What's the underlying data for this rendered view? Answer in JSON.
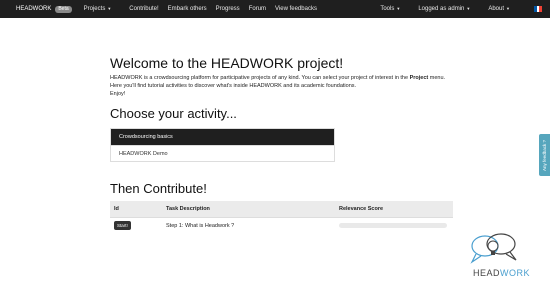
{
  "navbar": {
    "brand": "HEADWORK",
    "beta": "Beta",
    "left_items": [
      "Projects",
      "Contribute!",
      "Embark others",
      "Progress",
      "Forum",
      "View feedbacks"
    ],
    "right_items": [
      "Tools",
      "Logged as admin",
      "About"
    ],
    "flag_colors": [
      "#0055a4",
      "#ffffff",
      "#ef4135"
    ]
  },
  "main": {
    "title": "Welcome to the HEADWORK project!",
    "intro_1": "HEADWORK is a crowdsourcing platform for participative projects of any kind. You can select your project of interest in the",
    "intro_bold": "Project",
    "intro_2": " menu. Here you'll find tutorial activities to discover what's inside HEADWORK and its academic foundations.",
    "intro_3": "Enjoy!",
    "choose_heading": "Choose your activity...",
    "activities": [
      "Crowdsourcing basics",
      "HEADWORK Demo"
    ],
    "contribute_heading": "Then Contribute!",
    "table": {
      "headers": [
        "Id",
        "Task Description",
        "Relevance Score"
      ],
      "rows": [
        {
          "button": "Start!",
          "description": "Step 1: What is Headwork ?",
          "relevance": 0
        }
      ]
    }
  },
  "feedback_tab": "Any feedback ?",
  "logo": {
    "text_dark": "HEAD",
    "text_accent": "WORK"
  },
  "colors": {
    "navbar": "#1f1f1f",
    "accent": "#56a6bd"
  }
}
